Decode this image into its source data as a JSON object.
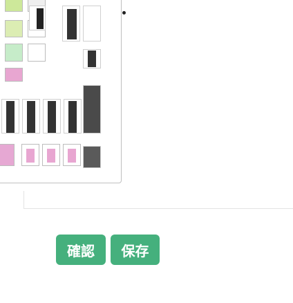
{
  "buttons": {
    "confirm_label": "確認",
    "save_label": "保存"
  },
  "palette": {
    "column1_colors": [
      "#d8ec95",
      "#d9ef95",
      "#cdefbf",
      "#e89ac9",
      "#e6b2d2"
    ],
    "column2_colors": [
      "#e8e8a0",
      "#e2a6d5",
      "#a7e3d8",
      "#e7b0d3"
    ],
    "column3_colors": [
      "#e5e5e5",
      "#e5e5e5",
      "#e5e5e5",
      "#e5e5e5"
    ]
  },
  "colors": {
    "button_bg": "#45b07d",
    "dark_swatch": "#3c3c3c"
  }
}
